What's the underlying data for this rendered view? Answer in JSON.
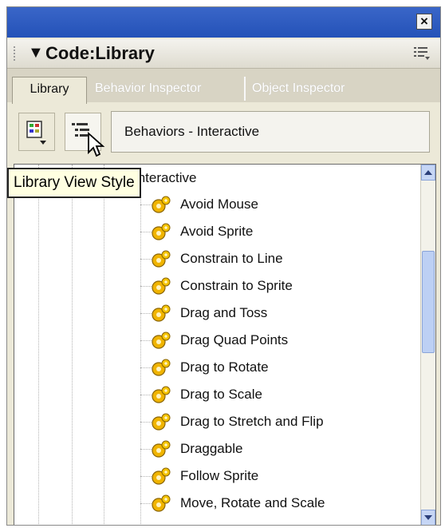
{
  "window": {
    "close_label": "×"
  },
  "panel": {
    "title": "Code:Library"
  },
  "tabs": [
    {
      "label": "Library",
      "active": true
    },
    {
      "label": "Behavior Inspector",
      "active": false
    },
    {
      "label": "Object Inspector",
      "active": false
    }
  ],
  "toolbar": {
    "library_list_button_icon": "library-list-icon",
    "view_style_button_icon": "view-style-icon",
    "library_selection": "Behaviors - Interactive"
  },
  "tooltip": {
    "text": "Library View Style"
  },
  "tree": {
    "category_label": "Interactive",
    "items": [
      "Avoid Mouse",
      "Avoid Sprite",
      "Constrain to Line",
      "Constrain to Sprite",
      "Drag and Toss",
      "Drag Quad Points",
      "Drag to Rotate",
      "Drag to Scale",
      "Drag to Stretch and Flip",
      "Draggable",
      "Follow Sprite",
      "Move, Rotate and Scale"
    ]
  },
  "colors": {
    "titlebar": "#2452b8",
    "panel_bg": "#ece9d8",
    "tooltip_bg": "#ffffe1",
    "gear": "#f0b400"
  }
}
